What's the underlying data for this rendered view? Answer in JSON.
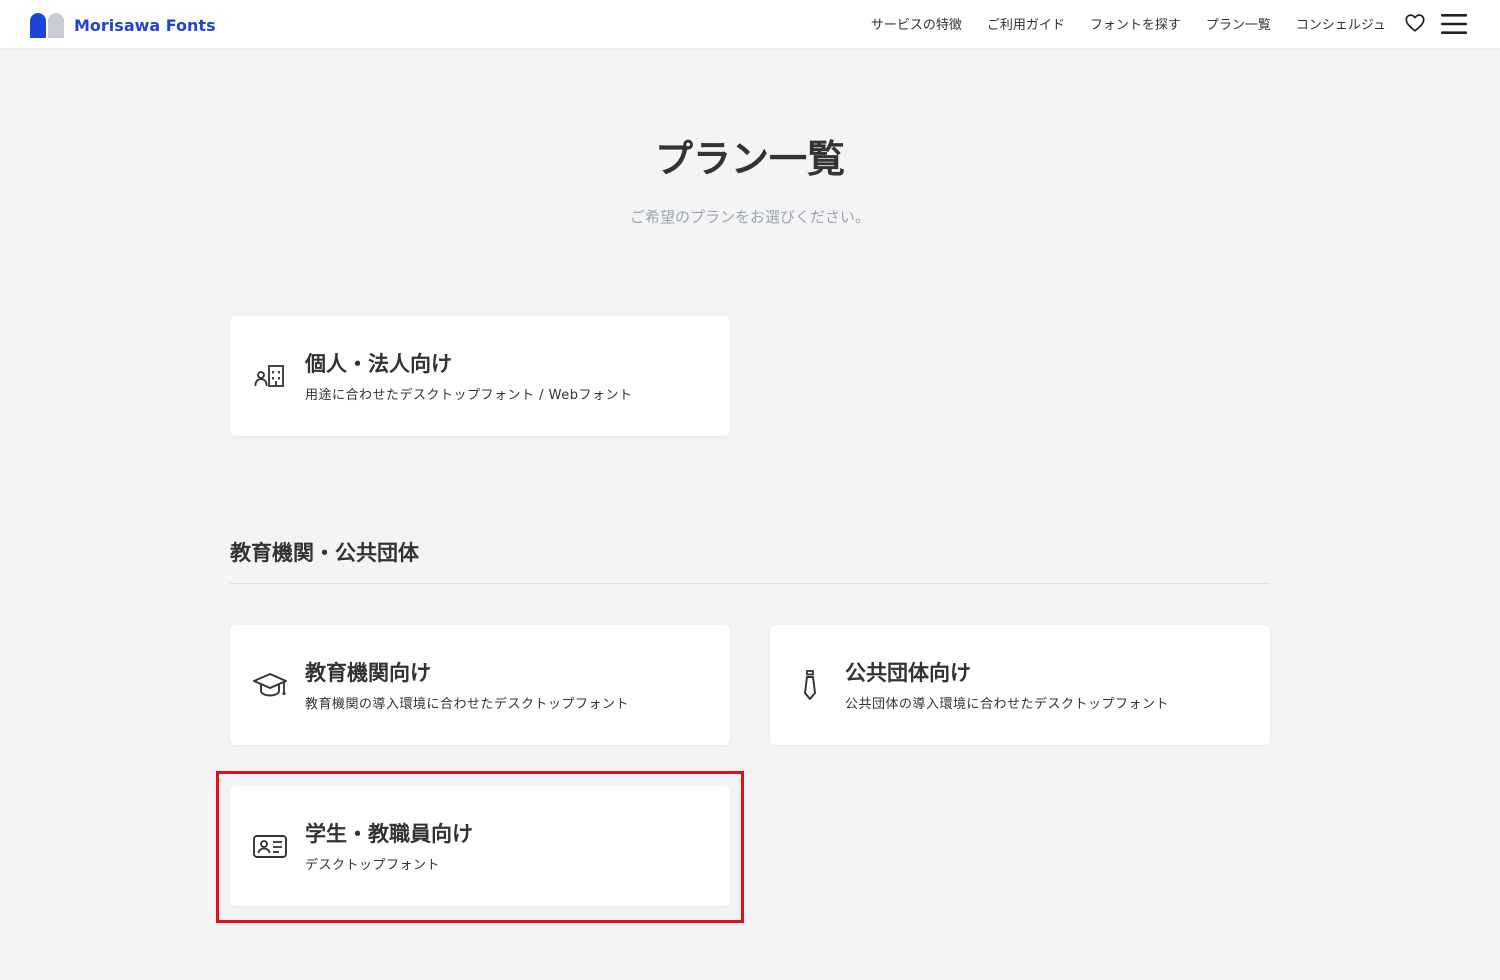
{
  "header": {
    "brand": "Morisawa Fonts",
    "brand_color": "#1d46d9",
    "nav": [
      {
        "label": "サービスの特徴"
      },
      {
        "label": "ご利用ガイド"
      },
      {
        "label": "フォントを探す"
      },
      {
        "label": "プラン一覧"
      },
      {
        "label": "コンシェルジュ"
      }
    ],
    "icons": [
      "heart-icon",
      "hamburger-menu-icon"
    ]
  },
  "main": {
    "title": "プラン一覧",
    "subtitle": "ご希望のプランをお選びください。",
    "personal_plans": [
      {
        "icon": "person-building-icon",
        "title": "個人・法人向け",
        "description": "用途に合わせたデスクトップフォント / Webフォント"
      }
    ],
    "education_section": {
      "heading": "教育機関・公共団体",
      "plans": [
        {
          "icon": "graduation-cap-icon",
          "title": "教育機関向け",
          "description": "教育機関の導入環境に合わせたデスクトップフォント"
        },
        {
          "icon": "tie-icon",
          "title": "公共団体向け",
          "description": "公共団体の導入環境に合わせたデスクトップフォント"
        },
        {
          "icon": "id-card-icon",
          "title": "学生・教職員向け",
          "description": "デスクトップフォント"
        }
      ]
    }
  },
  "highlight": {
    "target": "学生・教職員向け",
    "color": "#e0101a"
  }
}
